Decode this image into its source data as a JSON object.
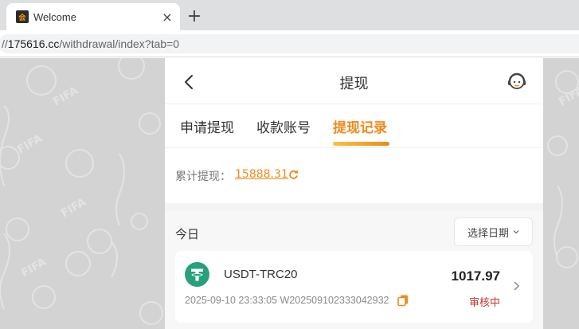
{
  "browser": {
    "tab_title": "Welcome",
    "favicon_text": "会",
    "close_glyph": "×",
    "new_tab_glyph": "+",
    "url_scheme": "//",
    "url_host": "175616.cc",
    "url_path": "/withdrawal/index?tab=0"
  },
  "header": {
    "title": "提现",
    "back_icon": "chevron-left-icon",
    "support_icon": "customer-service-icon"
  },
  "tabs": [
    {
      "label": "申请提现",
      "active": false
    },
    {
      "label": "收款账号",
      "active": false
    },
    {
      "label": "提现记录",
      "active": true
    }
  ],
  "summary": {
    "label": "累计提现：",
    "value": "15888.31"
  },
  "section": {
    "today_label": "今日",
    "date_filter_label": "选择日期"
  },
  "records": [
    {
      "coin": "USDT-TRC20",
      "amount": "1017.97",
      "meta": "2025-09-10 23:33:05 W202509102333042932",
      "status": "审核中"
    }
  ],
  "background": {
    "watermark_text": "FIFA"
  },
  "colors": {
    "accent": "#f08a1c",
    "status_pending": "#c0392b",
    "tether": "#26a17b"
  }
}
